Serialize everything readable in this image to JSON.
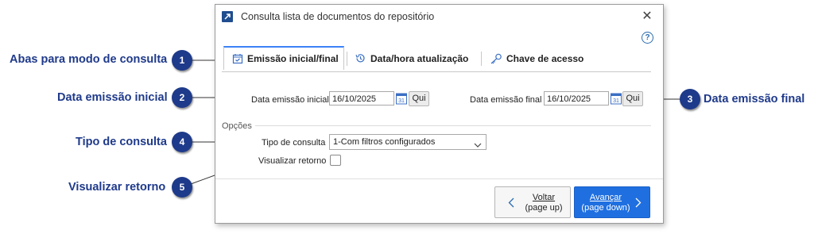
{
  "callouts": [
    {
      "num": "1",
      "label": "Abas para modo de consulta"
    },
    {
      "num": "2",
      "label": "Data emissão inicial"
    },
    {
      "num": "3",
      "label": "Data emissão final"
    },
    {
      "num": "4",
      "label": "Tipo de consulta"
    },
    {
      "num": "5",
      "label": "Visualizar retorno"
    }
  ],
  "window": {
    "title": "Consulta lista de documentos do repositório",
    "close_glyph": "✕",
    "help_glyph": "?"
  },
  "tabs": [
    {
      "label": "Emissão inicial/final",
      "icon": "calendar-check-icon",
      "active": true
    },
    {
      "label": "Data/hora atualização",
      "icon": "history-icon",
      "active": false
    },
    {
      "label": "Chave de acesso",
      "icon": "key-icon",
      "active": false
    }
  ],
  "form": {
    "start_date_label": "Data emissão inicial",
    "start_date_value": "16/10/2025",
    "start_weekday_button": "Qui",
    "end_date_label": "Data emissão final",
    "end_date_value": "16/10/2025",
    "end_weekday_button": "Qui",
    "calendar_day": "31",
    "options_section": "Opções",
    "query_type_label": "Tipo de consulta",
    "query_type_value": "1-Com filtros configurados",
    "show_return_label": "Visualizar retorno",
    "show_return_checked": false
  },
  "footer": {
    "back_line1": "Voltar",
    "back_line2": "(page up)",
    "next_line1": "Avançar",
    "next_line2": "(page down)"
  },
  "colors": {
    "callout_badge": "#1e3a8a",
    "callout_text": "#1f3a8a",
    "primary_button": "#1f6fe0",
    "active_tab_accent": "#3b82f6"
  }
}
